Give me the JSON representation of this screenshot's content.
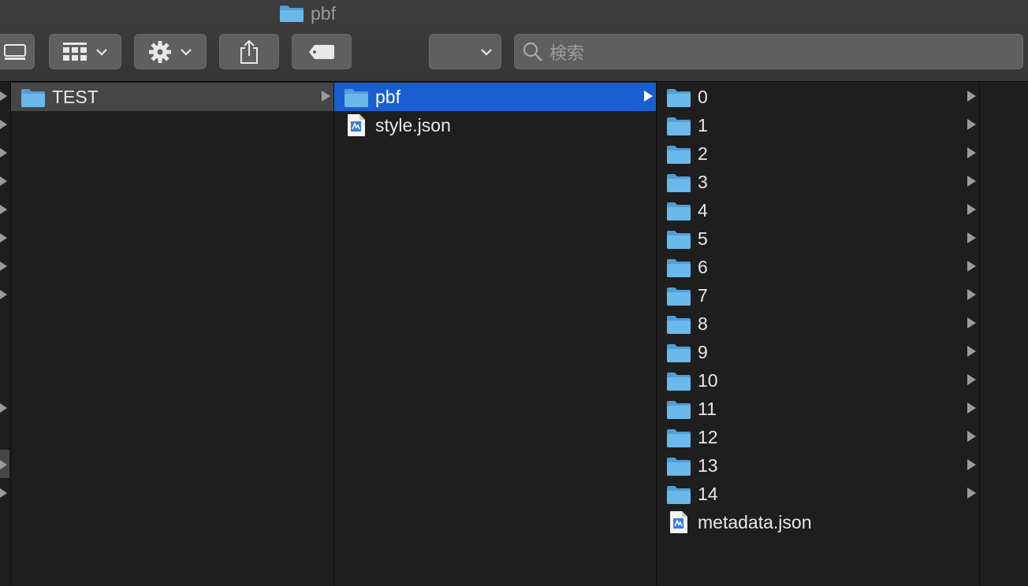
{
  "window": {
    "title": "pbf"
  },
  "toolbar": {
    "buttons": [
      {
        "name": "view-icon-button",
        "icon": "icon-view-icon"
      },
      {
        "name": "group-button",
        "icon": "grid-icon"
      },
      {
        "name": "action-button",
        "icon": "gear-icon"
      },
      {
        "name": "share-button",
        "icon": "share-icon"
      },
      {
        "name": "tag-button",
        "icon": "tag-icon"
      },
      {
        "name": "path-dropdown",
        "icon": "chevron-down-icon"
      }
    ],
    "search": {
      "placeholder": "検索",
      "icon": "search-icon"
    }
  },
  "columns": {
    "col1": [
      {
        "label": "TEST",
        "type": "folder",
        "has_children": true,
        "selected": "inactive"
      }
    ],
    "col2": [
      {
        "label": "pbf",
        "type": "folder",
        "has_children": true,
        "selected": "active"
      },
      {
        "label": "style.json",
        "type": "file",
        "has_children": false
      }
    ],
    "col3": [
      {
        "label": "0",
        "type": "folder"
      },
      {
        "label": "1",
        "type": "folder"
      },
      {
        "label": "2",
        "type": "folder"
      },
      {
        "label": "3",
        "type": "folder"
      },
      {
        "label": "4",
        "type": "folder"
      },
      {
        "label": "5",
        "type": "folder"
      },
      {
        "label": "6",
        "type": "folder"
      },
      {
        "label": "7",
        "type": "folder"
      },
      {
        "label": "8",
        "type": "folder"
      },
      {
        "label": "9",
        "type": "folder"
      },
      {
        "label": "10",
        "type": "folder"
      },
      {
        "label": "11",
        "type": "folder"
      },
      {
        "label": "12",
        "type": "folder"
      },
      {
        "label": "13",
        "type": "folder"
      },
      {
        "label": "14",
        "type": "folder"
      },
      {
        "label": "metadata.json",
        "type": "file"
      }
    ]
  },
  "colors": {
    "selection_active": "#1a5fd1",
    "selection_inactive": "#464646",
    "folder": "#5aaee6"
  }
}
